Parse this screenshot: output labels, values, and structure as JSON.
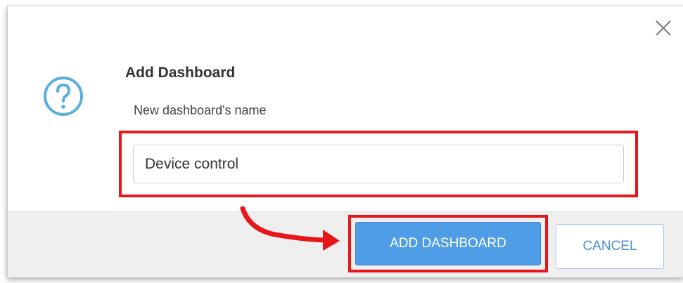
{
  "dialog": {
    "title": "Add Dashboard",
    "field_label": "New dashboard's name",
    "input_value": "Device control",
    "help_icon": "question-circle-icon",
    "close_icon": "close-icon"
  },
  "footer": {
    "primary_button_label": "ADD DASHBOARD",
    "secondary_button_label": "CANCEL"
  },
  "annotations": {
    "highlight_color": "#e8161a",
    "arrow_color": "#e8161a"
  },
  "colors": {
    "primary_button": "#4f9de6",
    "secondary_button_text": "#4a8dcc",
    "icon_color": "#5aaee0",
    "footer_background": "#efefef"
  }
}
